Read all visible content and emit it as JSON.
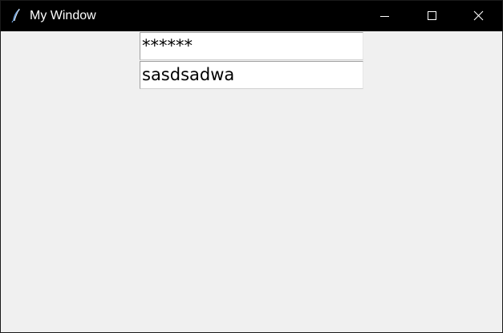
{
  "window": {
    "title": "My Window",
    "icon": "feather-icon"
  },
  "controls": {
    "minimize_icon": "minimize-icon",
    "maximize_icon": "maximize-icon",
    "close_icon": "close-icon"
  },
  "form": {
    "password_value": "******",
    "text_value": "sasdsadwa"
  }
}
